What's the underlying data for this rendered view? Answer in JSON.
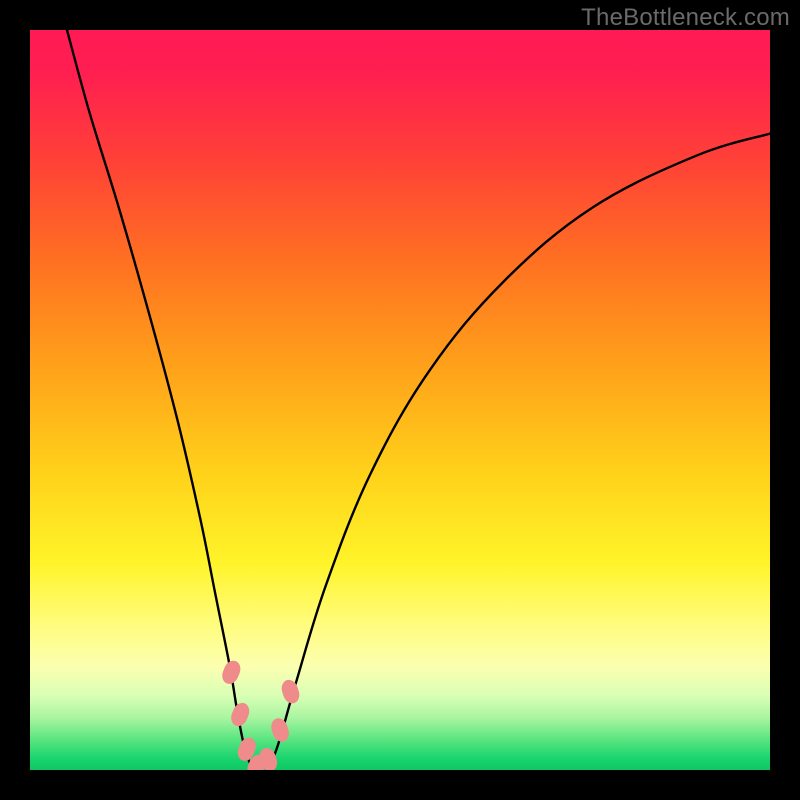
{
  "watermark": "TheBottleneck.com",
  "colors": {
    "frame": "#000000",
    "gradient_stops": [
      {
        "offset": 0.0,
        "color": "#ff1a55"
      },
      {
        "offset": 0.06,
        "color": "#ff1f50"
      },
      {
        "offset": 0.18,
        "color": "#ff4236"
      },
      {
        "offset": 0.32,
        "color": "#ff7321"
      },
      {
        "offset": 0.46,
        "color": "#ffa31a"
      },
      {
        "offset": 0.6,
        "color": "#ffd21a"
      },
      {
        "offset": 0.72,
        "color": "#fff42a"
      },
      {
        "offset": 0.8,
        "color": "#fffc7a"
      },
      {
        "offset": 0.86,
        "color": "#fcffb0"
      },
      {
        "offset": 0.9,
        "color": "#d8ffb5"
      },
      {
        "offset": 0.93,
        "color": "#a8f5a0"
      },
      {
        "offset": 0.96,
        "color": "#56e47f"
      },
      {
        "offset": 0.985,
        "color": "#18d46e"
      },
      {
        "offset": 1.0,
        "color": "#0fc763"
      }
    ],
    "curve": "#000000",
    "marker_fill": "#ef8b8b",
    "marker_stroke": "#c05050"
  },
  "chart_data": {
    "type": "line",
    "title": "",
    "xlabel": "",
    "ylabel": "",
    "xlim": [
      0,
      100
    ],
    "ylim": [
      0,
      100
    ],
    "note": "V-shaped bottleneck curve; values approximate (no axis labels in source).",
    "series": [
      {
        "name": "bottleneck-curve",
        "x": [
          5,
          8,
          12,
          16,
          20,
          23,
          25,
          27,
          28,
          29,
          30,
          31,
          32,
          33,
          34,
          36,
          40,
          46,
          54,
          64,
          76,
          90,
          100
        ],
        "y": [
          100,
          89,
          76,
          62,
          47,
          34,
          24,
          14,
          8,
          3,
          0.5,
          0.3,
          0.6,
          2,
          5,
          12,
          25,
          40,
          54,
          66,
          76,
          83,
          86
        ]
      }
    ],
    "markers": {
      "name": "highlight-points",
      "x": [
        27.2,
        28.4,
        29.3,
        30.6,
        32.2,
        33.8,
        35.2
      ],
      "y": [
        13.2,
        7.5,
        2.8,
        0.5,
        1.4,
        5.4,
        10.6
      ]
    }
  }
}
